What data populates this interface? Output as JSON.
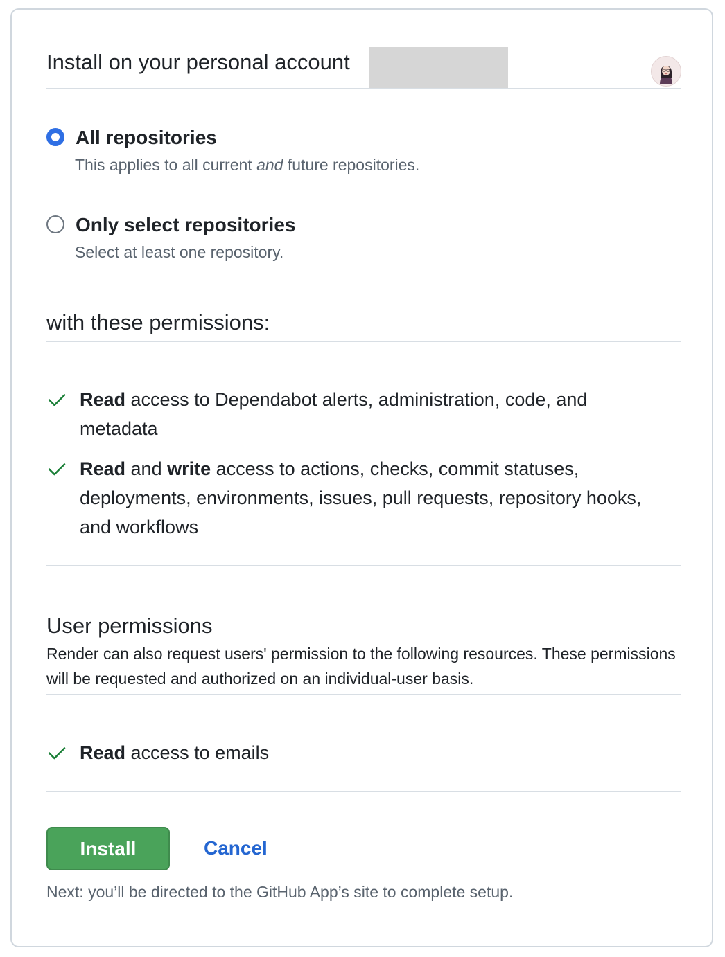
{
  "header": {
    "title": "Install on your personal account",
    "avatar_icon": "user-avatar"
  },
  "repository_access": {
    "options": [
      {
        "label": "All repositories",
        "description_before": "This applies to all current ",
        "description_emphasis": "and",
        "description_after": " future repositories.",
        "selected": true
      },
      {
        "label": "Only select repositories",
        "description": "Select at least one repository.",
        "selected": false
      }
    ]
  },
  "permissions": {
    "title": "with these permissions:",
    "items": [
      {
        "bold1": "Read",
        "text1": " access to Dependabot alerts, administration, code, and metadata"
      },
      {
        "bold1": "Read",
        "text1": " and ",
        "bold2": "write",
        "text2": " access to actions, checks, commit statuses, deployments, environments, issues, pull requests, repository hooks, and workflows"
      }
    ]
  },
  "user_permissions": {
    "title": "User permissions",
    "description": "Render can also request users' permission to the following resources. These permissions will be requested and authorized on an individual-user basis.",
    "items": [
      {
        "bold1": "Read",
        "text1": " access to emails"
      }
    ]
  },
  "actions": {
    "install_label": "Install",
    "cancel_label": "Cancel",
    "next_note": "Next: you’ll be directed to the GitHub App’s site to complete setup."
  },
  "colors": {
    "radio_accent": "#2f6fe4",
    "check_green": "#1a7f37",
    "install_green": "#4aa35a",
    "link_blue": "#2466d1"
  }
}
